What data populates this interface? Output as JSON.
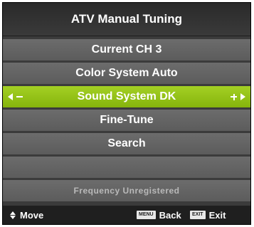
{
  "menu": {
    "title": "ATV Manual Tuning",
    "items": [
      {
        "label": "Current CH 3"
      },
      {
        "label": "Color System Auto"
      },
      {
        "label": "Sound System DK"
      },
      {
        "label": "Fine-Tune"
      },
      {
        "label": "Search"
      },
      {
        "label": ""
      }
    ],
    "status": "Frequency Unregistered"
  },
  "footer": {
    "move_label": "Move",
    "menu_key": "MENU",
    "back_label": "Back",
    "exit_key": "EXIT",
    "exit_label": "Exit"
  },
  "colors": {
    "highlight": "#9bc41a",
    "row": "#666666",
    "background": "#3b3b3b"
  }
}
